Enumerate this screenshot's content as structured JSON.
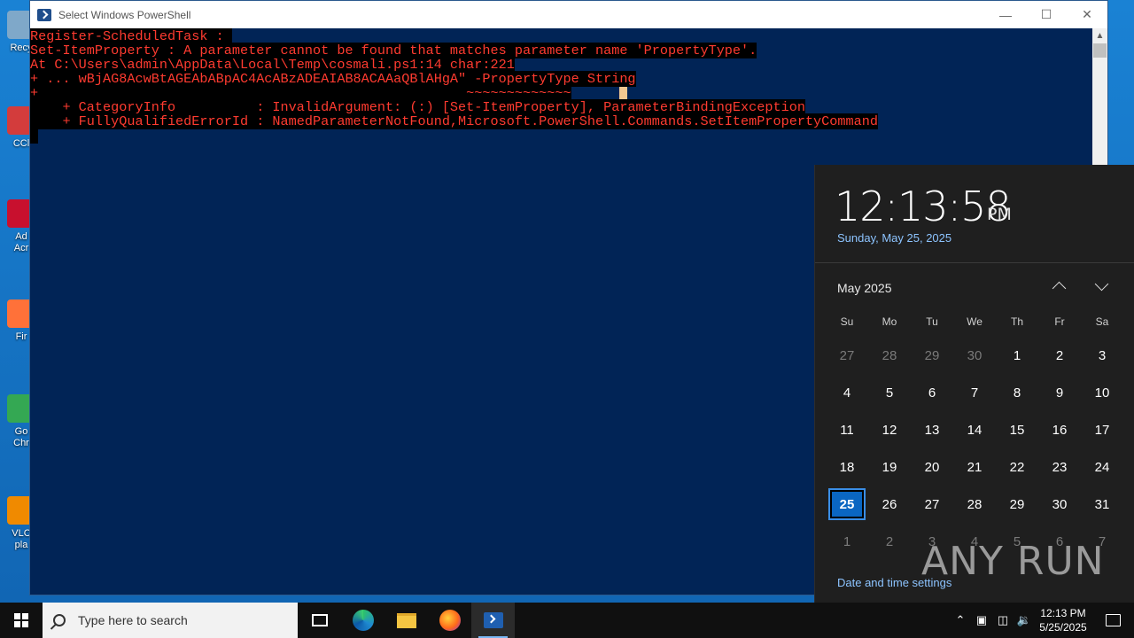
{
  "desktop": {
    "icons": [
      {
        "label": "Recy",
        "color": "#7fa8c9"
      },
      {
        "label": "CCl",
        "color": "#d33c3c"
      },
      {
        "label": "Ad\nAcr",
        "color": "#c8102e"
      },
      {
        "label": "Fir",
        "color": "#ff7139"
      },
      {
        "label": "Go\nChr",
        "color": "#34a853"
      },
      {
        "label": "VLC\npla",
        "color": "#f08a00"
      }
    ]
  },
  "window": {
    "title": "Select Windows PowerShell",
    "console_lines": [
      "Register-ScheduledTask : ",
      "Set-ItemProperty : A parameter cannot be found that matches parameter name 'PropertyType'.",
      "At C:\\Users\\admin\\AppData\\Local\\Temp\\cosmali.ps1:14 char:221",
      "+ ... wBjAG8AcwBtAGEAbABpAC4AcABzADEAIAB8ACAAaQBlAHgA\" -PropertyType String",
      "+                                                     ~~~~~~~~~~~~~",
      "    + CategoryInfo          : InvalidArgument: (:) [Set-ItemProperty], ParameterBindingException",
      "    + FullyQualifiedErrorId : NamedParameterNotFound,Microsoft.PowerShell.Commands.SetItemPropertyCommand",
      " "
    ]
  },
  "clock_flyout": {
    "time": "12:13:58",
    "ampm": "PM",
    "long_date": "Sunday, May 25, 2025",
    "month_label": "May 2025",
    "weekdays": [
      "Su",
      "Mo",
      "Tu",
      "We",
      "Th",
      "Fr",
      "Sa"
    ],
    "days": [
      {
        "d": "27",
        "muted": true
      },
      {
        "d": "28",
        "muted": true
      },
      {
        "d": "29",
        "muted": true
      },
      {
        "d": "30",
        "muted": true
      },
      {
        "d": "1"
      },
      {
        "d": "2"
      },
      {
        "d": "3"
      },
      {
        "d": "4"
      },
      {
        "d": "5"
      },
      {
        "d": "6"
      },
      {
        "d": "7"
      },
      {
        "d": "8"
      },
      {
        "d": "9"
      },
      {
        "d": "10"
      },
      {
        "d": "11"
      },
      {
        "d": "12"
      },
      {
        "d": "13"
      },
      {
        "d": "14"
      },
      {
        "d": "15"
      },
      {
        "d": "16"
      },
      {
        "d": "17"
      },
      {
        "d": "18"
      },
      {
        "d": "19"
      },
      {
        "d": "20"
      },
      {
        "d": "21"
      },
      {
        "d": "22"
      },
      {
        "d": "23"
      },
      {
        "d": "24"
      },
      {
        "d": "25",
        "today": true
      },
      {
        "d": "26"
      },
      {
        "d": "27"
      },
      {
        "d": "28"
      },
      {
        "d": "29"
      },
      {
        "d": "30"
      },
      {
        "d": "31"
      },
      {
        "d": "1",
        "muted": true
      },
      {
        "d": "2",
        "muted": true
      },
      {
        "d": "3",
        "muted": true
      },
      {
        "d": "4",
        "muted": true
      },
      {
        "d": "5",
        "muted": true
      },
      {
        "d": "6",
        "muted": true
      },
      {
        "d": "7",
        "muted": true
      }
    ],
    "settings_link": "Date and time settings"
  },
  "watermark": "ANY RUN",
  "taskbar": {
    "search_placeholder": "Type here to search",
    "tray_time": "12:13 PM",
    "tray_date": "5/25/2025"
  },
  "colors": {
    "console_bg": "#012456",
    "console_error_text": "#ff3b30",
    "accent": "#0a66c2"
  }
}
